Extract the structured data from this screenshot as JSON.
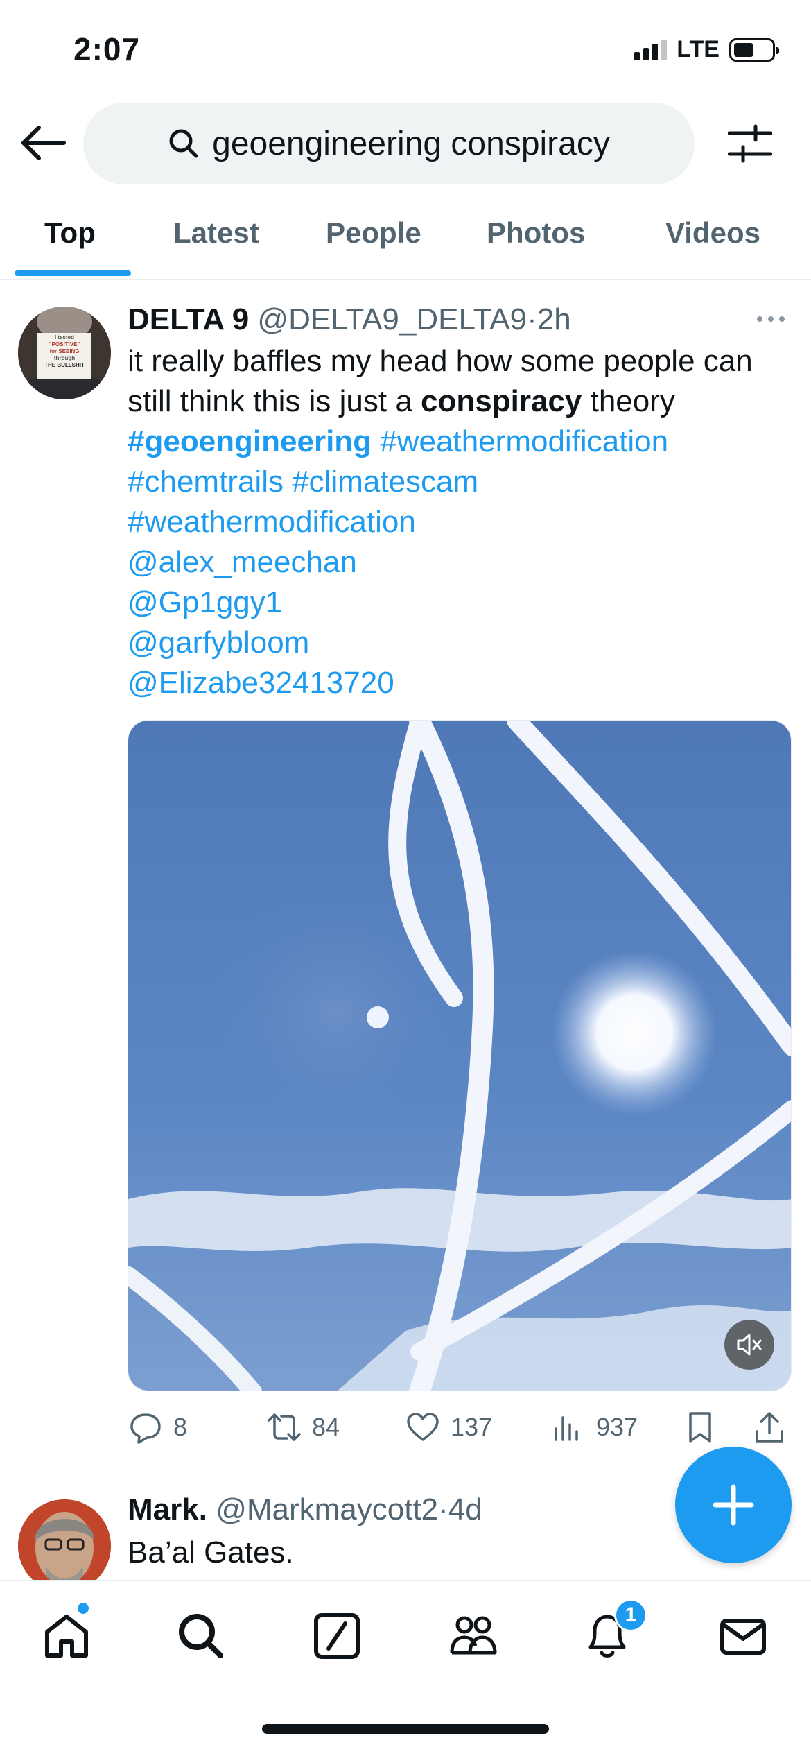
{
  "status_bar": {
    "time": "2:07",
    "network": "LTE"
  },
  "search": {
    "query": "geoengineering conspiracy"
  },
  "tabs": [
    {
      "label": "Top",
      "active": true
    },
    {
      "label": "Latest",
      "active": false
    },
    {
      "label": "People",
      "active": false
    },
    {
      "label": "Photos",
      "active": false
    },
    {
      "label": "Videos",
      "active": false
    }
  ],
  "tweets": [
    {
      "author": "DELTA 9",
      "handle": "@DELTA9_DELTA9",
      "time_sep": "·",
      "time": "2h",
      "avatar_text": [
        "I tested",
        "\"POSITIVE\"",
        "for SEEING",
        "through",
        "THE BULLSHIT"
      ],
      "body": {
        "line1": "it really baffles my head  how some people can",
        "line2_a": "still think this is just a ",
        "line2_b": "conspiracy",
        "line2_c": " theory",
        "hashtags": [
          "#geoengineering",
          "#weathermodification",
          "#chemtrails",
          "#climatescam",
          "#weathermodification"
        ],
        "mentions": [
          "@alex_meechan",
          "@Gp1ggy1",
          "@garfybloom",
          "@Elizabe32413720"
        ]
      },
      "counts": {
        "replies": "8",
        "reposts": "84",
        "likes": "137",
        "views": "937"
      }
    },
    {
      "author": "Mark.",
      "handle": "@Markmaycott2",
      "time_sep": "·",
      "time": "4d",
      "body": {
        "line1": "Ba’al Gates."
      }
    }
  ],
  "bottom_nav": {
    "notifications_badge": "1"
  },
  "colors": {
    "accent": "#1d9bf0",
    "text": "#0f1419",
    "secondary": "#536471"
  }
}
